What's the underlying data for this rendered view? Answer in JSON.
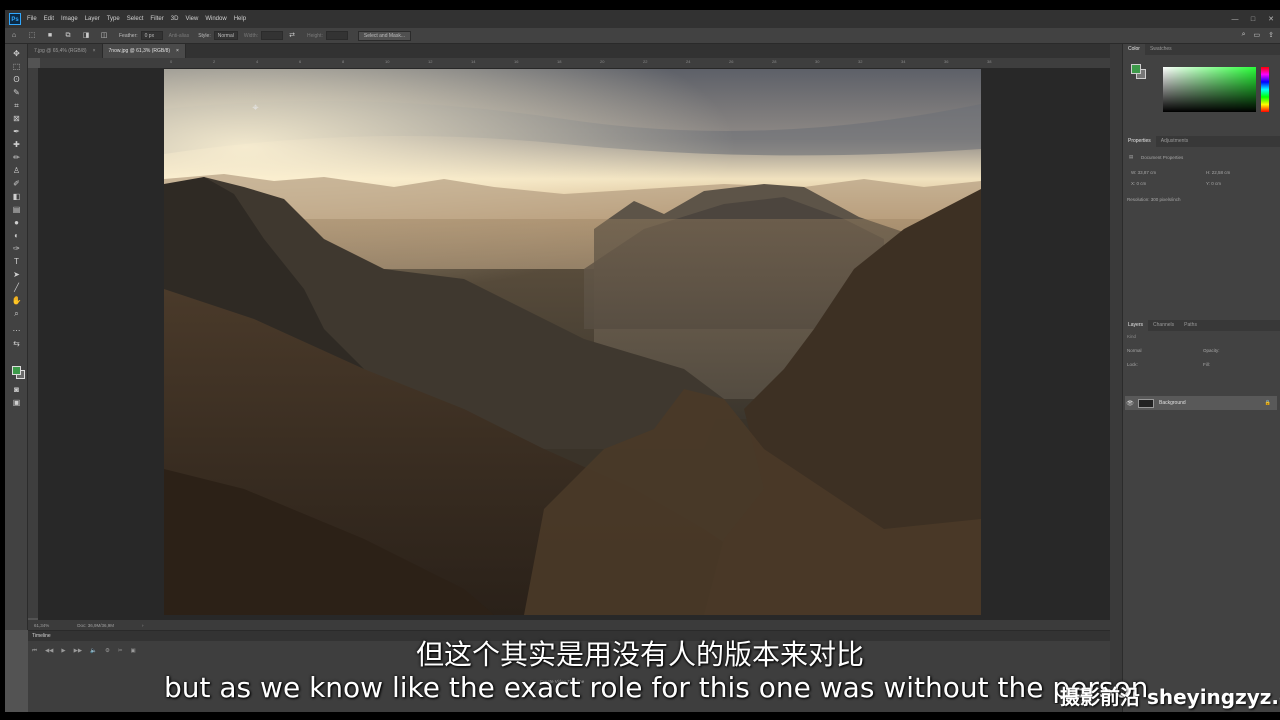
{
  "app": {
    "logo": "Ps",
    "menu": [
      "File",
      "Edit",
      "Image",
      "Layer",
      "Type",
      "Select",
      "Filter",
      "3D",
      "View",
      "Window",
      "Help"
    ],
    "window_controls": [
      "—",
      "□",
      "✕"
    ]
  },
  "options_bar": {
    "feather_label": "Feather:",
    "feather_value": "0 px",
    "anti_alias_label": "Anti-alias",
    "style_label": "Style:",
    "style_value": "Normal",
    "width_label": "Width:",
    "height_label": "Height:",
    "select_mask_label": "Select and Mask..."
  },
  "tabs": [
    {
      "label": "7.jpg @ 65,4% (RGB/8)",
      "close": "×"
    },
    {
      "label": "7now.jpg @ 61,3% (RGB/8)",
      "close": "×"
    }
  ],
  "ruler_ticks": [
    "0",
    "2",
    "4",
    "6",
    "8",
    "10",
    "12",
    "14",
    "16",
    "18",
    "20",
    "22",
    "24",
    "26",
    "28",
    "30",
    "32",
    "34",
    "36",
    "38"
  ],
  "status": {
    "zoom": "61,34%",
    "doc": "Doc: 36,9M/36,9M",
    "arrow": "›"
  },
  "timeline": {
    "title": "Timeline",
    "create_button": "Create Video Timeline",
    "menu": "≡",
    "controls": [
      "⏮",
      "◀◀",
      "▶",
      "▶▶",
      "🔈",
      "⚙",
      "✂",
      "▣"
    ]
  },
  "color_panel": {
    "tabs": [
      "Color",
      "Swatches"
    ],
    "fg_color": "#3d9a4a",
    "bg_color": "#777777"
  },
  "properties_panel": {
    "tabs": [
      "Properties",
      "Adjustments"
    ],
    "title": "Document Properties",
    "width": "W: 33,87 cm",
    "height": "H: 22,58 cm",
    "x": "X: 0 cm",
    "y": "Y: 0 cm",
    "resolution": "Resolution: 300 pixels/inch"
  },
  "layers_panel": {
    "tabs": [
      "Layers",
      "Channels",
      "Paths"
    ],
    "kind_label": "Kind",
    "mode_label": "Normal",
    "opacity_label": "Opacity:",
    "fill_label": "Fill:",
    "lock_label": "Lock:",
    "layer_name": "Background",
    "eye": "👁",
    "lock_icon": "🔒"
  },
  "subtitles": {
    "chinese": "但这个其实是用没有人的版本来对比",
    "english": "but as we know like the exact role for this one was without the person",
    "watermark": "摄影前沿 sheyingzyz.com"
  }
}
